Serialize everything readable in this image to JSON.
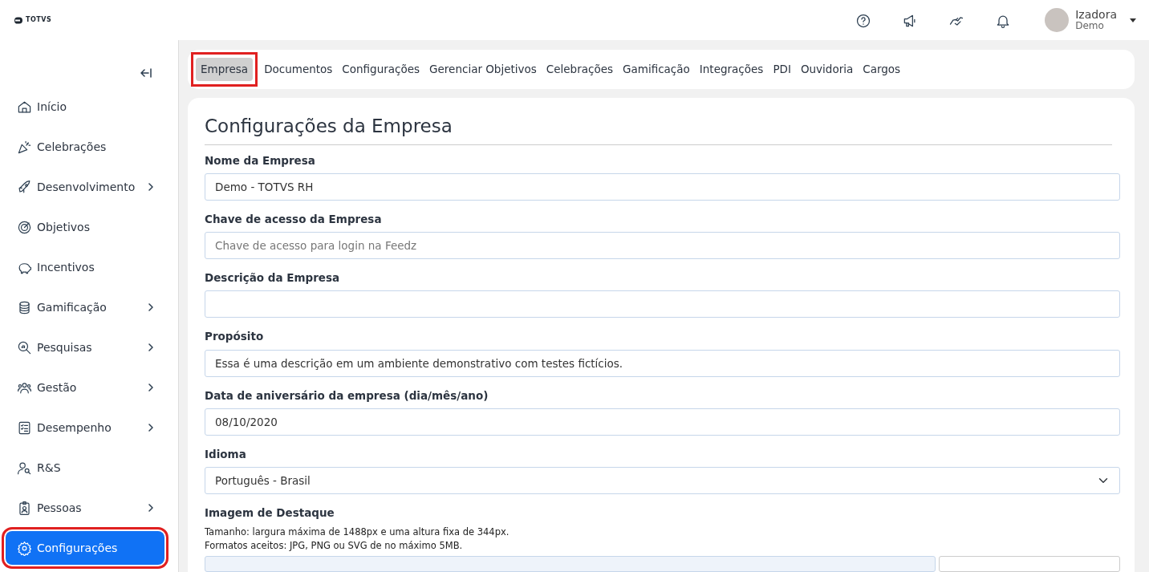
{
  "header": {
    "logo": "TOTVS",
    "user": {
      "name": "Izadora",
      "subtitle": "Demo"
    }
  },
  "sidebar": {
    "items": [
      {
        "label": "Início",
        "has_children": false,
        "selected": false,
        "highlighted": false
      },
      {
        "label": "Celebrações",
        "has_children": false,
        "selected": false,
        "highlighted": false
      },
      {
        "label": "Desenvolvimento",
        "has_children": true,
        "selected": false,
        "highlighted": false
      },
      {
        "label": "Objetivos",
        "has_children": false,
        "selected": false,
        "highlighted": false
      },
      {
        "label": "Incentivos",
        "has_children": false,
        "selected": false,
        "highlighted": false
      },
      {
        "label": "Gamificação",
        "has_children": true,
        "selected": false,
        "highlighted": false
      },
      {
        "label": "Pesquisas",
        "has_children": true,
        "selected": false,
        "highlighted": false
      },
      {
        "label": "Gestão",
        "has_children": true,
        "selected": false,
        "highlighted": false
      },
      {
        "label": "Desempenho",
        "has_children": true,
        "selected": false,
        "highlighted": false
      },
      {
        "label": "R&S",
        "has_children": false,
        "selected": false,
        "highlighted": false
      },
      {
        "label": "Pessoas",
        "has_children": true,
        "selected": false,
        "highlighted": false
      },
      {
        "label": "Configurações",
        "has_children": false,
        "selected": true,
        "highlighted": true
      }
    ]
  },
  "tabs": [
    {
      "label": "Empresa",
      "selected": true,
      "highlighted": true
    },
    {
      "label": "Documentos",
      "selected": false,
      "highlighted": false
    },
    {
      "label": "Configurações",
      "selected": false,
      "highlighted": false
    },
    {
      "label": "Gerenciar Objetivos",
      "selected": false,
      "highlighted": false
    },
    {
      "label": "Celebrações",
      "selected": false,
      "highlighted": false
    },
    {
      "label": "Gamificação",
      "selected": false,
      "highlighted": false
    },
    {
      "label": "Integrações",
      "selected": false,
      "highlighted": false
    },
    {
      "label": "PDI",
      "selected": false,
      "highlighted": false
    },
    {
      "label": "Ouvidoria",
      "selected": false,
      "highlighted": false
    },
    {
      "label": "Cargos",
      "selected": false,
      "highlighted": false
    }
  ],
  "form": {
    "title": "Configurações da Empresa",
    "fields": [
      {
        "kind": "text",
        "label": "Nome da Empresa",
        "value": "Demo - TOTVS RH"
      },
      {
        "kind": "text",
        "label": "Chave de acesso da Empresa",
        "placeholder": "Chave de acesso para login na Feedz"
      },
      {
        "kind": "text",
        "label": "Descrição da Empresa"
      },
      {
        "kind": "text",
        "label": "Propósito",
        "value": "Essa é uma descrição em um ambiente demonstrativo com testes fictícios."
      },
      {
        "kind": "text",
        "label": "Data de aniversário da empresa (dia/mês/ano)",
        "value": "08/10/2020"
      },
      {
        "kind": "select",
        "label": "Idioma",
        "value": "Português - Brasil"
      },
      {
        "kind": "file",
        "label": "Imagem de Destaque",
        "help": [
          "Tamanho: largura máxima de 1488px e uma altura fixa de 344px.",
          "Formatos aceitos: JPG, PNG ou SVG de no máximo 5MB."
        ]
      }
    ]
  }
}
